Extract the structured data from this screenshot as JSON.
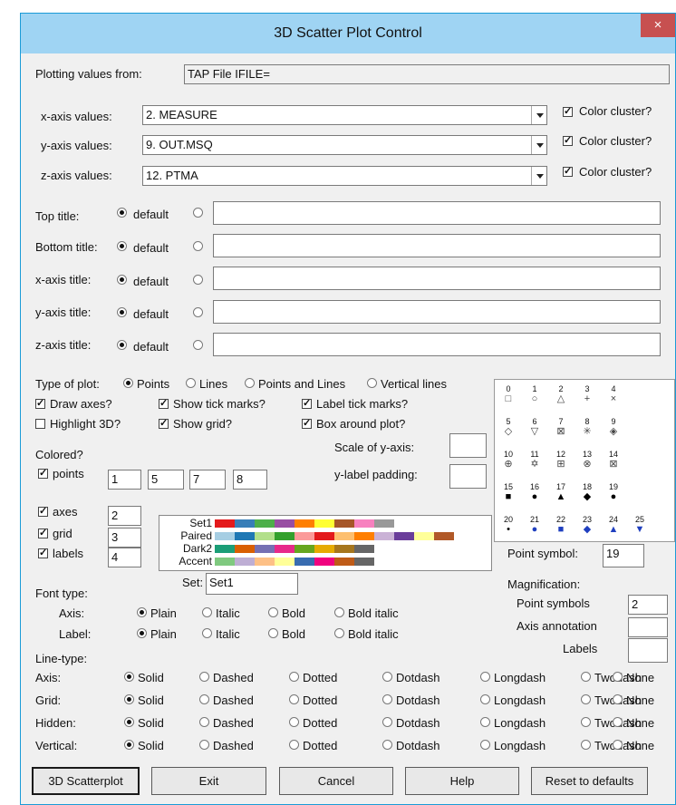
{
  "window": {
    "title": "3D Scatter Plot Control",
    "close": "×"
  },
  "source": {
    "label": "Plotting values from:",
    "value": "TAP File IFILE="
  },
  "axes": [
    {
      "label": "x-axis values:",
      "value": "2. MEASURE",
      "cluster": "Color cluster?",
      "checked": true
    },
    {
      "label": "y-axis values:",
      "value": "9. OUT.MSQ",
      "cluster": "Color cluster?",
      "checked": true
    },
    {
      "label": "z-axis values:",
      "value": "12. PTMA",
      "cluster": "Color cluster?",
      "checked": true
    }
  ],
  "titles": [
    {
      "label": "Top title:",
      "default": "default"
    },
    {
      "label": "Bottom title:",
      "default": "default"
    },
    {
      "label": "x-axis title:",
      "default": "default"
    },
    {
      "label": "y-axis title:",
      "default": "default"
    },
    {
      "label": "z-axis title:",
      "default": "default"
    }
  ],
  "plot_type": {
    "label": "Type of plot:",
    "options": [
      "Points",
      "Lines",
      "Points and Lines",
      "Vertical lines"
    ],
    "selected": 0
  },
  "options": {
    "draw_axes": "Draw axes?",
    "show_tick": "Show tick marks?",
    "label_tick": "Label tick marks?",
    "highlight": "Highlight 3D?",
    "show_grid": "Show grid?",
    "box_around": "Box around plot?"
  },
  "scale_y": {
    "label": "Scale of y-axis:",
    "value": ""
  },
  "ylabel_pad": {
    "label": "y-label padding:",
    "value": ""
  },
  "colored": {
    "label": "Colored?",
    "points": {
      "label": "points",
      "values": [
        "1",
        "5",
        "7",
        "8"
      ]
    },
    "axes": {
      "label": "axes",
      "value": "2"
    },
    "grid": {
      "label": "grid",
      "value": "3"
    },
    "labels": {
      "label": "labels",
      "value": "4"
    }
  },
  "palettes": [
    {
      "name": "Set1",
      "colors": [
        "#e41a1c",
        "#377eb8",
        "#4daf4a",
        "#984ea3",
        "#ff7f00",
        "#ffff33",
        "#a65628",
        "#f781bf",
        "#999999"
      ]
    },
    {
      "name": "Paired",
      "colors": [
        "#a6cee3",
        "#1f78b4",
        "#b2df8a",
        "#33a02c",
        "#fb9a99",
        "#e31a1c",
        "#fdbf6f",
        "#ff7f00",
        "#cab2d6",
        "#6a3d9a",
        "#ffff99",
        "#b15928"
      ]
    },
    {
      "name": "Dark2",
      "colors": [
        "#1b9e77",
        "#d95f02",
        "#7570b3",
        "#e7298a",
        "#66a61e",
        "#e6ab02",
        "#a6761d",
        "#666666"
      ]
    },
    {
      "name": "Accent",
      "colors": [
        "#7fc97f",
        "#beaed4",
        "#fdc086",
        "#ffff99",
        "#386cb0",
        "#f0027f",
        "#bf5b17",
        "#666666"
      ]
    }
  ],
  "set": {
    "label": "Set:",
    "value": "Set1"
  },
  "symbols": {
    "rows": [
      [
        {
          "n": "0",
          "g": "□"
        },
        {
          "n": "1",
          "g": "○"
        },
        {
          "n": "2",
          "g": "△"
        },
        {
          "n": "3",
          "g": "+"
        },
        {
          "n": "4",
          "g": "×"
        }
      ],
      [
        {
          "n": "5",
          "g": "◇"
        },
        {
          "n": "6",
          "g": "▽"
        },
        {
          "n": "7",
          "g": "⊠"
        },
        {
          "n": "8",
          "g": "✳"
        },
        {
          "n": "9",
          "g": "◈"
        }
      ],
      [
        {
          "n": "10",
          "g": "⊕"
        },
        {
          "n": "11",
          "g": "✡"
        },
        {
          "n": "12",
          "g": "⊞"
        },
        {
          "n": "13",
          "g": "⊗"
        },
        {
          "n": "14",
          "g": "⊠"
        }
      ],
      [
        {
          "n": "15",
          "g": "■"
        },
        {
          "n": "16",
          "g": "●"
        },
        {
          "n": "17",
          "g": "▲"
        },
        {
          "n": "18",
          "g": "◆"
        },
        {
          "n": "19",
          "g": "●"
        }
      ],
      [
        {
          "n": "20",
          "g": "•"
        },
        {
          "n": "21",
          "g": "●"
        },
        {
          "n": "22",
          "g": "■"
        },
        {
          "n": "23",
          "g": "◆"
        },
        {
          "n": "24",
          "g": "▲"
        },
        {
          "n": "25",
          "g": "▼"
        }
      ]
    ],
    "label": "Point symbol:",
    "value": "19"
  },
  "magnification": {
    "label": "Magnification:",
    "point_symbols": {
      "label": "Point symbols",
      "value": "2"
    },
    "axis_annotation": {
      "label": "Axis annotation",
      "value": ""
    },
    "labels": {
      "label": "Labels",
      "value": ""
    }
  },
  "font_type": {
    "label": "Font type:",
    "options": [
      "Plain",
      "Italic",
      "Bold",
      "Bold italic"
    ],
    "rows": [
      {
        "label": "Axis:",
        "selected": 0
      },
      {
        "label": "Label:",
        "selected": 0
      }
    ]
  },
  "line_type": {
    "label": "Line-type:",
    "options": [
      "Solid",
      "Dashed",
      "Dotted",
      "Dotdash",
      "Longdash",
      "Twodash",
      "None"
    ],
    "rows": [
      {
        "label": "Axis:",
        "selected": 0
      },
      {
        "label": "Grid:",
        "selected": 0
      },
      {
        "label": "Hidden:",
        "selected": 0
      },
      {
        "label": "Vertical:",
        "selected": 0
      }
    ]
  },
  "buttons": [
    "3D Scatterplot",
    "Exit",
    "Cancel",
    "Help",
    "Reset to defaults"
  ]
}
